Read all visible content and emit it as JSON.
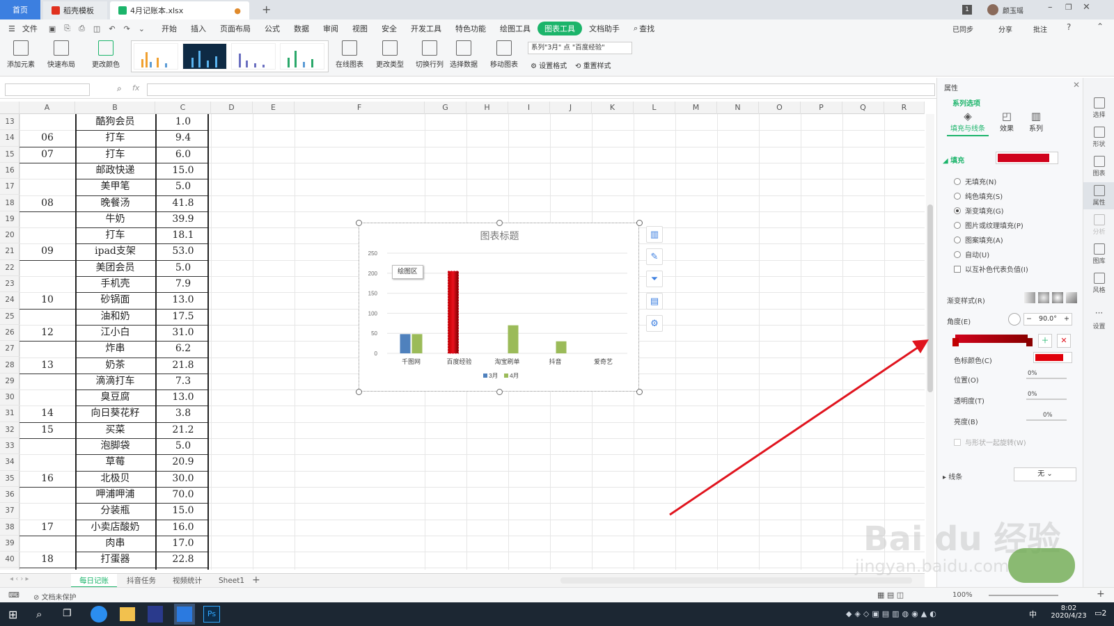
{
  "titlebar": {
    "home_tab": "首页",
    "template_tab": "稻壳模板",
    "file_tab": "4月记账本.xlsx",
    "badge": "1",
    "user": "颜玉瑶"
  },
  "menu": {
    "file": "文件",
    "items": [
      "开始",
      "插入",
      "页面布局",
      "公式",
      "数据",
      "审阅",
      "视图",
      "安全",
      "开发工具",
      "特色功能",
      "绘图工具"
    ],
    "active": "图表工具",
    "items_after": [
      "文档助手"
    ],
    "search": "查找",
    "sync": "已同步",
    "share": "分享",
    "comment": "批注"
  },
  "ribbon": {
    "add_element": "添加元素",
    "quick_layout": "快速布局",
    "change_color": "更改颜色",
    "online_chart": "在线图表",
    "change_type": "更改类型",
    "switch_rowcol": "切换行列",
    "select_data": "选择数据",
    "move_chart": "移动图表",
    "series_select": "系列\"3月\" 点 \"百度经验\"",
    "set_format": "设置格式",
    "reset_style": "重置样式"
  },
  "formula": {
    "fx": "fx"
  },
  "columns": [
    "A",
    "B",
    "C",
    "D",
    "E",
    "F",
    "G",
    "H",
    "I",
    "J",
    "K",
    "L",
    "M",
    "N",
    "O",
    "P",
    "Q",
    "R"
  ],
  "rows": [
    {
      "n": "13",
      "a": "",
      "b": "酷狗会员",
      "c": "1.0"
    },
    {
      "n": "14",
      "a": "06",
      "b": "打车",
      "c": "9.4"
    },
    {
      "n": "15",
      "a": "07",
      "b": "打车",
      "c": "6.0"
    },
    {
      "n": "16",
      "a": "",
      "b": "邮政快递",
      "c": "15.0"
    },
    {
      "n": "17",
      "a": "",
      "b": "美甲笔",
      "c": "5.0"
    },
    {
      "n": "18",
      "a": "08",
      "b": "晚餐汤",
      "c": "41.8"
    },
    {
      "n": "19",
      "a": "",
      "b": "牛奶",
      "c": "39.9"
    },
    {
      "n": "20",
      "a": "",
      "b": "打车",
      "c": "18.1"
    },
    {
      "n": "21",
      "a": "09",
      "b": "ipad支架",
      "c": "53.0"
    },
    {
      "n": "22",
      "a": "",
      "b": "美团会员",
      "c": "5.0"
    },
    {
      "n": "23",
      "a": "",
      "b": "手机壳",
      "c": "7.9"
    },
    {
      "n": "24",
      "a": "10",
      "b": "砂锅面",
      "c": "13.0"
    },
    {
      "n": "25",
      "a": "",
      "b": "油和奶",
      "c": "17.5"
    },
    {
      "n": "26",
      "a": "12",
      "b": "江小白",
      "c": "31.0"
    },
    {
      "n": "27",
      "a": "",
      "b": "炸串",
      "c": "6.2"
    },
    {
      "n": "28",
      "a": "13",
      "b": "奶茶",
      "c": "21.8"
    },
    {
      "n": "29",
      "a": "",
      "b": "滴滴打车",
      "c": "7.3"
    },
    {
      "n": "30",
      "a": "",
      "b": "臭豆腐",
      "c": "13.0"
    },
    {
      "n": "31",
      "a": "14",
      "b": "向日葵花籽",
      "c": "3.8"
    },
    {
      "n": "32",
      "a": "15",
      "b": "买菜",
      "c": "21.2"
    },
    {
      "n": "33",
      "a": "",
      "b": "泡脚袋",
      "c": "5.0"
    },
    {
      "n": "34",
      "a": "",
      "b": "草莓",
      "c": "20.9"
    },
    {
      "n": "35",
      "a": "16",
      "b": "北极贝",
      "c": "30.0"
    },
    {
      "n": "36",
      "a": "",
      "b": "呷浦呷浦",
      "c": "70.0"
    },
    {
      "n": "37",
      "a": "",
      "b": "分装瓶",
      "c": "15.0"
    },
    {
      "n": "38",
      "a": "17",
      "b": "小卖店酸奶",
      "c": "16.0"
    },
    {
      "n": "39",
      "a": "",
      "b": "肉串",
      "c": "17.0"
    },
    {
      "n": "40",
      "a": "18",
      "b": "打蛋器",
      "c": "22.8"
    }
  ],
  "chart_data": {
    "type": "bar",
    "title": "图表标题",
    "categories": [
      "千图网",
      "百度经验",
      "淘宝刷单",
      "抖音",
      "爱奇艺"
    ],
    "series": [
      {
        "name": "3月",
        "values": [
          48,
          205,
          0,
          0,
          0
        ],
        "color": "#4f81bd"
      },
      {
        "name": "4月",
        "values": [
          48,
          0,
          70,
          30,
          0
        ],
        "color": "#9bbb59"
      }
    ],
    "ylim": [
      0,
      250
    ],
    "yticks": [
      0,
      50,
      100,
      150,
      200,
      250
    ],
    "legend": "bottom",
    "tooltip": "绘图区",
    "highlight_color": "#c00000"
  },
  "sheets": {
    "tabs": [
      "每日记账",
      "抖音任务",
      "视频统计",
      "Sheet1"
    ],
    "active": "每日记账"
  },
  "status": {
    "protect": "文档未保护",
    "zoom": "100%"
  },
  "panel": {
    "title": "属性",
    "series_options": "系列选项",
    "tab_fill": "填充与线条",
    "tab_effect": "效果",
    "tab_series": "系列",
    "fill": "填充",
    "fill_color": "#d0021b",
    "options": [
      "无填充(N)",
      "纯色填充(S)",
      "渐变填充(G)",
      "图片或纹理填充(P)",
      "图案填充(A)",
      "自动(U)"
    ],
    "selected_option": 2,
    "invert": "以互补色代表负值(I)",
    "gradient_style": "渐变样式(R)",
    "angle": "角度(E)",
    "angle_value": "90.0°",
    "stop_color": "色标颜色(C)",
    "position": "位置(O)",
    "position_value": "0%",
    "transparency": "透明度(T)",
    "transparency_value": "0%",
    "brightness": "亮度(B)",
    "brightness_value": "0%",
    "rotate_with_shape": "与形状一起旋转(W)",
    "line": "线条",
    "line_value": "无"
  },
  "farright": [
    "选择",
    "形状",
    "图表",
    "属性",
    "分析",
    "图库",
    "风格",
    "设置"
  ],
  "taskbar": {
    "time": "8:02",
    "date": "2020/4/23",
    "ime": "中",
    "notif": "2"
  },
  "watermark": {
    "text": "Bai du 经验",
    "url": "jingyan.baidu.com"
  }
}
